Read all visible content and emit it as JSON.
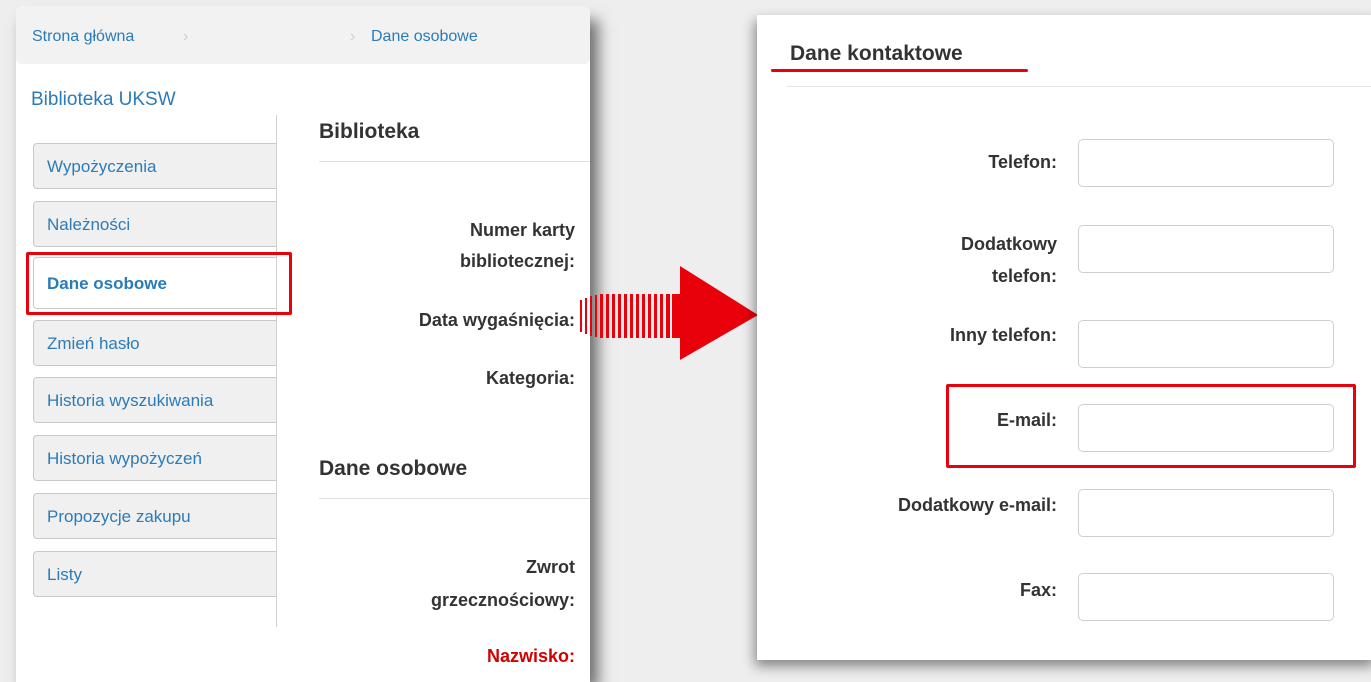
{
  "breadcrumb": {
    "home": "Strona główna",
    "sep": "›",
    "current": "Dane osobowe"
  },
  "library_link": "Biblioteka UKSW",
  "menu": [
    {
      "label": "Wypożyczenia"
    },
    {
      "label": "Należności"
    },
    {
      "label": "Dane osobowe"
    },
    {
      "label": "Zmień hasło"
    },
    {
      "label": "Historia wyszukiwania"
    },
    {
      "label": "Historia wypożyczeń"
    },
    {
      "label": "Propozycje zakupu"
    },
    {
      "label": "Listy"
    }
  ],
  "library_section": {
    "title": "Biblioteka",
    "card_number_line1": "Numer karty",
    "card_number_line2": "bibliotecznej:",
    "expiry": "Data wygaśnięcia:",
    "category": "Kategoria:"
  },
  "personal_section": {
    "title": "Dane osobowe",
    "salutation_line1": "Zwrot",
    "salutation_line2": "grzecznościowy:",
    "surname": "Nazwisko:"
  },
  "contact_section": {
    "title": "Dane kontaktowe",
    "phone": "Telefon:",
    "alt_phone_line1": "Dodatkowy",
    "alt_phone_line2": "telefon:",
    "other_phone": "Inny telefon:",
    "email": "E-mail:",
    "alt_email": "Dodatkowy e-mail:",
    "fax": "Fax:"
  },
  "colors": {
    "link": "#2b7bb9",
    "highlight": "#e8000b",
    "required": "#d40000"
  },
  "icons": {
    "arrow": "right-arrow-icon"
  }
}
